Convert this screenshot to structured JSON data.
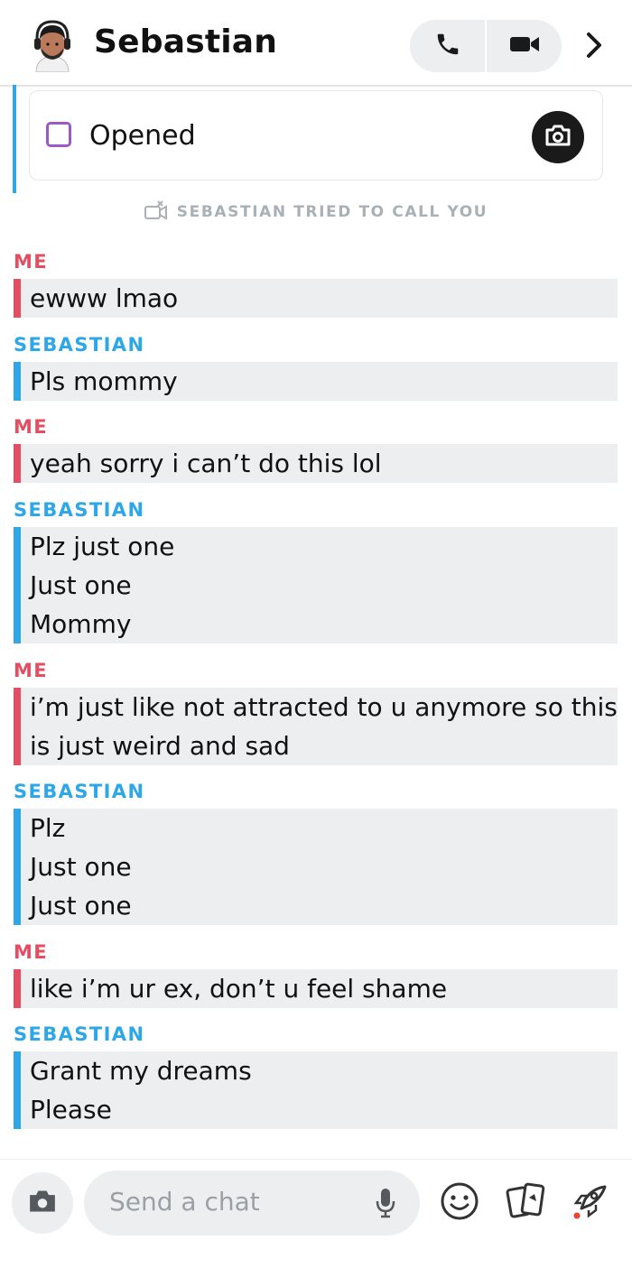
{
  "header": {
    "title": "Sebastian"
  },
  "opened": {
    "label": "Opened"
  },
  "missed_call": {
    "text": "SEBASTIAN TRIED TO CALL YOU"
  },
  "messages": [
    {
      "sender": "ME",
      "lines": [
        "ewww lmao"
      ]
    },
    {
      "sender": "SEBASTIAN",
      "lines": [
        "Pls mommy"
      ]
    },
    {
      "sender": "ME",
      "lines": [
        "yeah sorry i can’t do this lol"
      ]
    },
    {
      "sender": "SEBASTIAN",
      "lines": [
        "Plz just one",
        "Just one",
        "Mommy"
      ]
    },
    {
      "sender": "ME",
      "lines": [
        "i’m just like not attracted to u anymore so this",
        "is just weird and sad"
      ]
    },
    {
      "sender": "SEBASTIAN",
      "lines": [
        "Plz",
        "Just one",
        "Just one"
      ]
    },
    {
      "sender": "ME",
      "lines": [
        "like i’m ur ex, don’t u feel shame"
      ]
    },
    {
      "sender": "SEBASTIAN",
      "lines": [
        "Grant my dreams",
        "Please"
      ]
    }
  ],
  "footer": {
    "placeholder": "Send a chat"
  },
  "colors": {
    "me": "#e54d62",
    "them": "#2ea7e8",
    "bubble_bg": "#eceef0",
    "checkbox": "#9b59c5"
  },
  "icons": [
    "bitmoji-avatar",
    "phone-icon",
    "video-camera-icon",
    "chevron-right-icon",
    "camera-icon",
    "missed-video-call-icon",
    "microphone-icon",
    "smiley-icon",
    "cards-icon",
    "rocket-icon"
  ]
}
